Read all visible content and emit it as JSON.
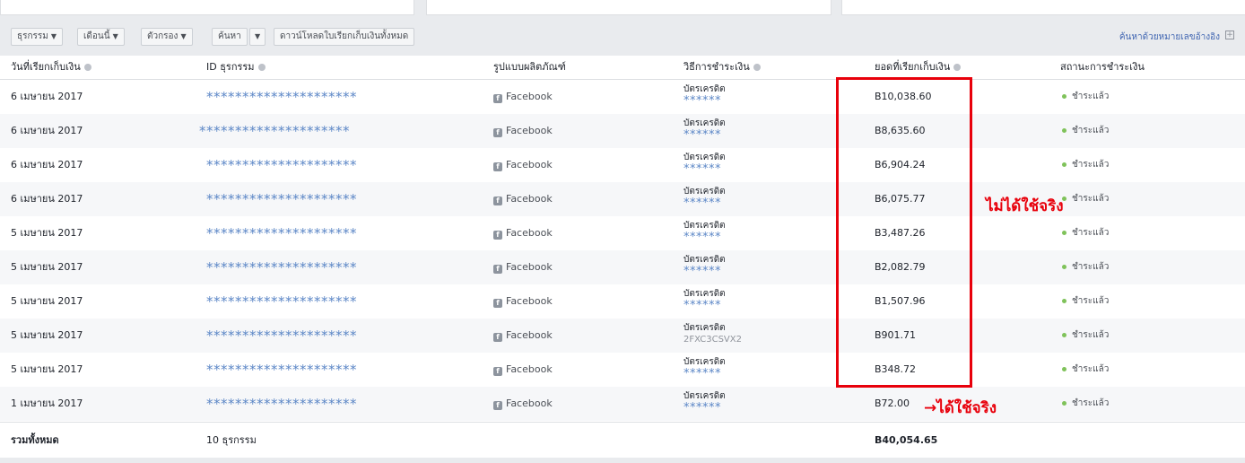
{
  "toolbar": {
    "transactions_btn": "ธุรกรรม",
    "month_btn": "เดือนนี้",
    "filter_btn": "ตัวกรอง",
    "search_btn": "ค้นหา",
    "download_btn": "ดาวน์โหลดใบเรียกเก็บเงินทั้งหมด",
    "search_reference_link": "ค้นหาด้วยหมายเลขอ้างอิง"
  },
  "columns": {
    "date": "วันที่เรียกเก็บเงิน",
    "id": "ID ธุรกรรม",
    "product": "รูปแบบผลิตภัณฑ์",
    "payment": "วิธีการชำระเงิน",
    "amount": "ยอดที่เรียกเก็บเงิน",
    "status": "สถานะการชำระเงิน"
  },
  "rows": [
    {
      "date": "6 เมษายน 2017",
      "id": "*********************",
      "product": "Facebook",
      "method": "บัตรเครดิต",
      "code": "******",
      "amount": "B10,038.60",
      "status": "ชำระแล้ว"
    },
    {
      "date": "6 เมษายน 2017",
      "id": "*********************",
      "product": "Facebook",
      "method": "บัตรเครดิต",
      "code": "******",
      "amount": "B8,635.60",
      "status": "ชำระแล้ว"
    },
    {
      "date": "6 เมษายน 2017",
      "id": "*********************",
      "product": "Facebook",
      "method": "บัตรเครดิต",
      "code": "******",
      "amount": "B6,904.24",
      "status": "ชำระแล้ว"
    },
    {
      "date": "6 เมษายน 2017",
      "id": "*********************",
      "product": "Facebook",
      "method": "บัตรเครดิต",
      "code": "******",
      "amount": "B6,075.77",
      "status": "ชำระแล้ว"
    },
    {
      "date": "5 เมษายน 2017",
      "id": "*********************",
      "product": "Facebook",
      "method": "บัตรเครดิต",
      "code": "******",
      "amount": "B3,487.26",
      "status": "ชำระแล้ว"
    },
    {
      "date": "5 เมษายน 2017",
      "id": "*********************",
      "product": "Facebook",
      "method": "บัตรเครดิต",
      "code": "******",
      "amount": "B2,082.79",
      "status": "ชำระแล้ว"
    },
    {
      "date": "5 เมษายน 2017",
      "id": "*********************",
      "product": "Facebook",
      "method": "บัตรเครดิต",
      "code": "******",
      "amount": "B1,507.96",
      "status": "ชำระแล้ว"
    },
    {
      "date": "5 เมษายน 2017",
      "id": "*********************",
      "product": "Facebook",
      "method": "บัตรเครดิต",
      "code": "2FXC3CSVX2",
      "amount": "B901.71",
      "status": "ชำระแล้ว"
    },
    {
      "date": "5 เมษายน 2017",
      "id": "*********************",
      "product": "Facebook",
      "method": "บัตรเครดิต",
      "code": "******",
      "amount": "B348.72",
      "status": "ชำระแล้ว"
    },
    {
      "date": "1 เมษายน 2017",
      "id": "*********************",
      "product": "Facebook",
      "method": "บัตรเครดิต",
      "code": "******",
      "amount": "B72.00",
      "status": "ชำระแล้ว"
    }
  ],
  "footer": {
    "label": "รวมทั้งหมด",
    "count": "10 ธุรกรรม",
    "total": "B40,054.65"
  },
  "annotations": {
    "not_used": "ไม่ได้ใช้จริง",
    "used": "→ได้ใช้จริง"
  },
  "colors": {
    "annotation": "#e8000b",
    "paid_dot": "#7fc25a",
    "mask": "#5b86c6"
  }
}
